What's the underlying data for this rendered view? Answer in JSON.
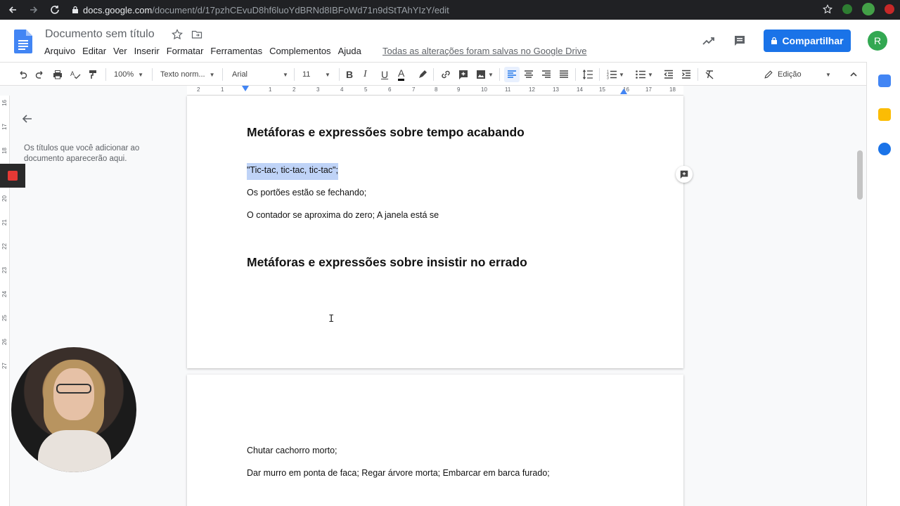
{
  "browser": {
    "url_host": "docs.google.com",
    "url_path": "/document/d/17pzhCEvuD8hf6luoYdBRNd8IBFoWd71n9dStTAhYIzY/edit"
  },
  "header": {
    "doc_title": "Documento sem título",
    "share_label": "Compartilhar",
    "avatar_letter": "R",
    "save_status": "Todas as alterações foram salvas no Google Drive",
    "menus": [
      "Arquivo",
      "Editar",
      "Ver",
      "Inserir",
      "Formatar",
      "Ferramentas",
      "Complementos",
      "Ajuda"
    ]
  },
  "toolbar": {
    "zoom": "100%",
    "style": "Texto norm...",
    "font": "Arial",
    "size": "11",
    "mode": "Edição"
  },
  "ruler": {
    "h_ticks": [
      "2",
      "1",
      "1",
      "2",
      "3",
      "4",
      "5",
      "6",
      "7",
      "8",
      "9",
      "10",
      "11",
      "12",
      "13",
      "14",
      "15",
      "16",
      "17",
      "18"
    ],
    "v_ticks": [
      "16",
      "17",
      "18",
      "19",
      "20",
      "21",
      "22",
      "23",
      "24",
      "25",
      "26",
      "27"
    ]
  },
  "outline": {
    "hint": "Os títulos que você adicionar ao documento aparecerão aqui."
  },
  "document": {
    "heading1": "Metáforas e expressões sobre tempo acabando",
    "line1": "\"Tic-tac, tic-tac, tic-tac\";",
    "line2": "Os portões estão se fechando;",
    "line3": "O contador se aproxima do zero; A janela está se",
    "heading2": "Metáforas e expressões sobre insistir no errado",
    "line4": "Chutar cachorro morto;",
    "line5": "Dar murro em ponta de faca; Regar árvore morta; Embarcar em barca furado;"
  },
  "colors": {
    "share_blue": "#1a73e8",
    "avatar_green": "#33a852",
    "selection": "#bfd3f7"
  }
}
